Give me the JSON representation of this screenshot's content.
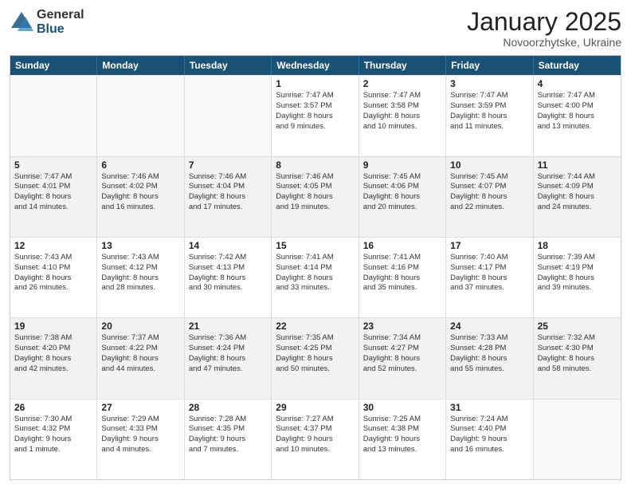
{
  "logo": {
    "general": "General",
    "blue": "Blue"
  },
  "header": {
    "title": "January 2025",
    "subtitle": "Novoorzhytske, Ukraine"
  },
  "days": [
    "Sunday",
    "Monday",
    "Tuesday",
    "Wednesday",
    "Thursday",
    "Friday",
    "Saturday"
  ],
  "rows": [
    [
      {
        "day": "",
        "lines": []
      },
      {
        "day": "",
        "lines": []
      },
      {
        "day": "",
        "lines": []
      },
      {
        "day": "1",
        "lines": [
          "Sunrise: 7:47 AM",
          "Sunset: 3:57 PM",
          "Daylight: 8 hours",
          "and 9 minutes."
        ]
      },
      {
        "day": "2",
        "lines": [
          "Sunrise: 7:47 AM",
          "Sunset: 3:58 PM",
          "Daylight: 8 hours",
          "and 10 minutes."
        ]
      },
      {
        "day": "3",
        "lines": [
          "Sunrise: 7:47 AM",
          "Sunset: 3:59 PM",
          "Daylight: 8 hours",
          "and 11 minutes."
        ]
      },
      {
        "day": "4",
        "lines": [
          "Sunrise: 7:47 AM",
          "Sunset: 4:00 PM",
          "Daylight: 8 hours",
          "and 13 minutes."
        ]
      }
    ],
    [
      {
        "day": "5",
        "lines": [
          "Sunrise: 7:47 AM",
          "Sunset: 4:01 PM",
          "Daylight: 8 hours",
          "and 14 minutes."
        ]
      },
      {
        "day": "6",
        "lines": [
          "Sunrise: 7:46 AM",
          "Sunset: 4:02 PM",
          "Daylight: 8 hours",
          "and 16 minutes."
        ]
      },
      {
        "day": "7",
        "lines": [
          "Sunrise: 7:46 AM",
          "Sunset: 4:04 PM",
          "Daylight: 8 hours",
          "and 17 minutes."
        ]
      },
      {
        "day": "8",
        "lines": [
          "Sunrise: 7:46 AM",
          "Sunset: 4:05 PM",
          "Daylight: 8 hours",
          "and 19 minutes."
        ]
      },
      {
        "day": "9",
        "lines": [
          "Sunrise: 7:45 AM",
          "Sunset: 4:06 PM",
          "Daylight: 8 hours",
          "and 20 minutes."
        ]
      },
      {
        "day": "10",
        "lines": [
          "Sunrise: 7:45 AM",
          "Sunset: 4:07 PM",
          "Daylight: 8 hours",
          "and 22 minutes."
        ]
      },
      {
        "day": "11",
        "lines": [
          "Sunrise: 7:44 AM",
          "Sunset: 4:09 PM",
          "Daylight: 8 hours",
          "and 24 minutes."
        ]
      }
    ],
    [
      {
        "day": "12",
        "lines": [
          "Sunrise: 7:43 AM",
          "Sunset: 4:10 PM",
          "Daylight: 8 hours",
          "and 26 minutes."
        ]
      },
      {
        "day": "13",
        "lines": [
          "Sunrise: 7:43 AM",
          "Sunset: 4:12 PM",
          "Daylight: 8 hours",
          "and 28 minutes."
        ]
      },
      {
        "day": "14",
        "lines": [
          "Sunrise: 7:42 AM",
          "Sunset: 4:13 PM",
          "Daylight: 8 hours",
          "and 30 minutes."
        ]
      },
      {
        "day": "15",
        "lines": [
          "Sunrise: 7:41 AM",
          "Sunset: 4:14 PM",
          "Daylight: 8 hours",
          "and 33 minutes."
        ]
      },
      {
        "day": "16",
        "lines": [
          "Sunrise: 7:41 AM",
          "Sunset: 4:16 PM",
          "Daylight: 8 hours",
          "and 35 minutes."
        ]
      },
      {
        "day": "17",
        "lines": [
          "Sunrise: 7:40 AM",
          "Sunset: 4:17 PM",
          "Daylight: 8 hours",
          "and 37 minutes."
        ]
      },
      {
        "day": "18",
        "lines": [
          "Sunrise: 7:39 AM",
          "Sunset: 4:19 PM",
          "Daylight: 8 hours",
          "and 39 minutes."
        ]
      }
    ],
    [
      {
        "day": "19",
        "lines": [
          "Sunrise: 7:38 AM",
          "Sunset: 4:20 PM",
          "Daylight: 8 hours",
          "and 42 minutes."
        ]
      },
      {
        "day": "20",
        "lines": [
          "Sunrise: 7:37 AM",
          "Sunset: 4:22 PM",
          "Daylight: 8 hours",
          "and 44 minutes."
        ]
      },
      {
        "day": "21",
        "lines": [
          "Sunrise: 7:36 AM",
          "Sunset: 4:24 PM",
          "Daylight: 8 hours",
          "and 47 minutes."
        ]
      },
      {
        "day": "22",
        "lines": [
          "Sunrise: 7:35 AM",
          "Sunset: 4:25 PM",
          "Daylight: 8 hours",
          "and 50 minutes."
        ]
      },
      {
        "day": "23",
        "lines": [
          "Sunrise: 7:34 AM",
          "Sunset: 4:27 PM",
          "Daylight: 8 hours",
          "and 52 minutes."
        ]
      },
      {
        "day": "24",
        "lines": [
          "Sunrise: 7:33 AM",
          "Sunset: 4:28 PM",
          "Daylight: 8 hours",
          "and 55 minutes."
        ]
      },
      {
        "day": "25",
        "lines": [
          "Sunrise: 7:32 AM",
          "Sunset: 4:30 PM",
          "Daylight: 8 hours",
          "and 58 minutes."
        ]
      }
    ],
    [
      {
        "day": "26",
        "lines": [
          "Sunrise: 7:30 AM",
          "Sunset: 4:32 PM",
          "Daylight: 9 hours",
          "and 1 minute."
        ]
      },
      {
        "day": "27",
        "lines": [
          "Sunrise: 7:29 AM",
          "Sunset: 4:33 PM",
          "Daylight: 9 hours",
          "and 4 minutes."
        ]
      },
      {
        "day": "28",
        "lines": [
          "Sunrise: 7:28 AM",
          "Sunset: 4:35 PM",
          "Daylight: 9 hours",
          "and 7 minutes."
        ]
      },
      {
        "day": "29",
        "lines": [
          "Sunrise: 7:27 AM",
          "Sunset: 4:37 PM",
          "Daylight: 9 hours",
          "and 10 minutes."
        ]
      },
      {
        "day": "30",
        "lines": [
          "Sunrise: 7:25 AM",
          "Sunset: 4:38 PM",
          "Daylight: 9 hours",
          "and 13 minutes."
        ]
      },
      {
        "day": "31",
        "lines": [
          "Sunrise: 7:24 AM",
          "Sunset: 4:40 PM",
          "Daylight: 9 hours",
          "and 16 minutes."
        ]
      },
      {
        "day": "",
        "lines": []
      }
    ]
  ]
}
